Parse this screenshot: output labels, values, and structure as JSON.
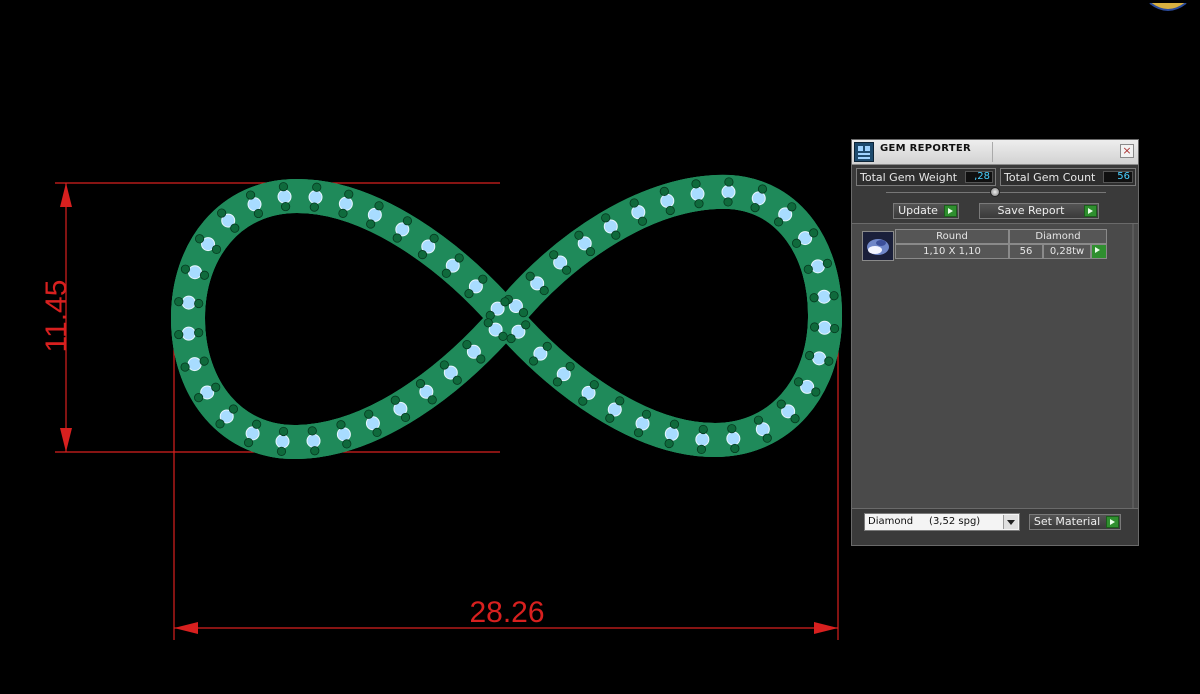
{
  "viewport": {
    "dimension_vertical": "11.45",
    "dimension_horizontal": "28.26",
    "dimension_color": "#d8201f",
    "ring_color": "#2fae77",
    "stone_color": "#8fd0ff",
    "prong_color": "#0f6a3c"
  },
  "panel": {
    "title": "GEM REPORTER",
    "close_icon": "close-icon",
    "total_weight_label": "Total Gem Weight",
    "total_weight_value": ",28",
    "total_count_label": "Total Gem Count",
    "total_count_value": "56",
    "update_label": "Update",
    "save_report_label": "Save Report",
    "report": {
      "headers": [
        "Round",
        "Diamond"
      ],
      "rows": [
        {
          "size": "1,10 X 1,10",
          "count": "56",
          "weight": "0,28tw"
        }
      ]
    },
    "material_select": "Diamond     (3,52 spg)",
    "set_material_label": "Set Material",
    "accent_green": "#2f8f2f",
    "value_color": "#4ad0ff"
  }
}
